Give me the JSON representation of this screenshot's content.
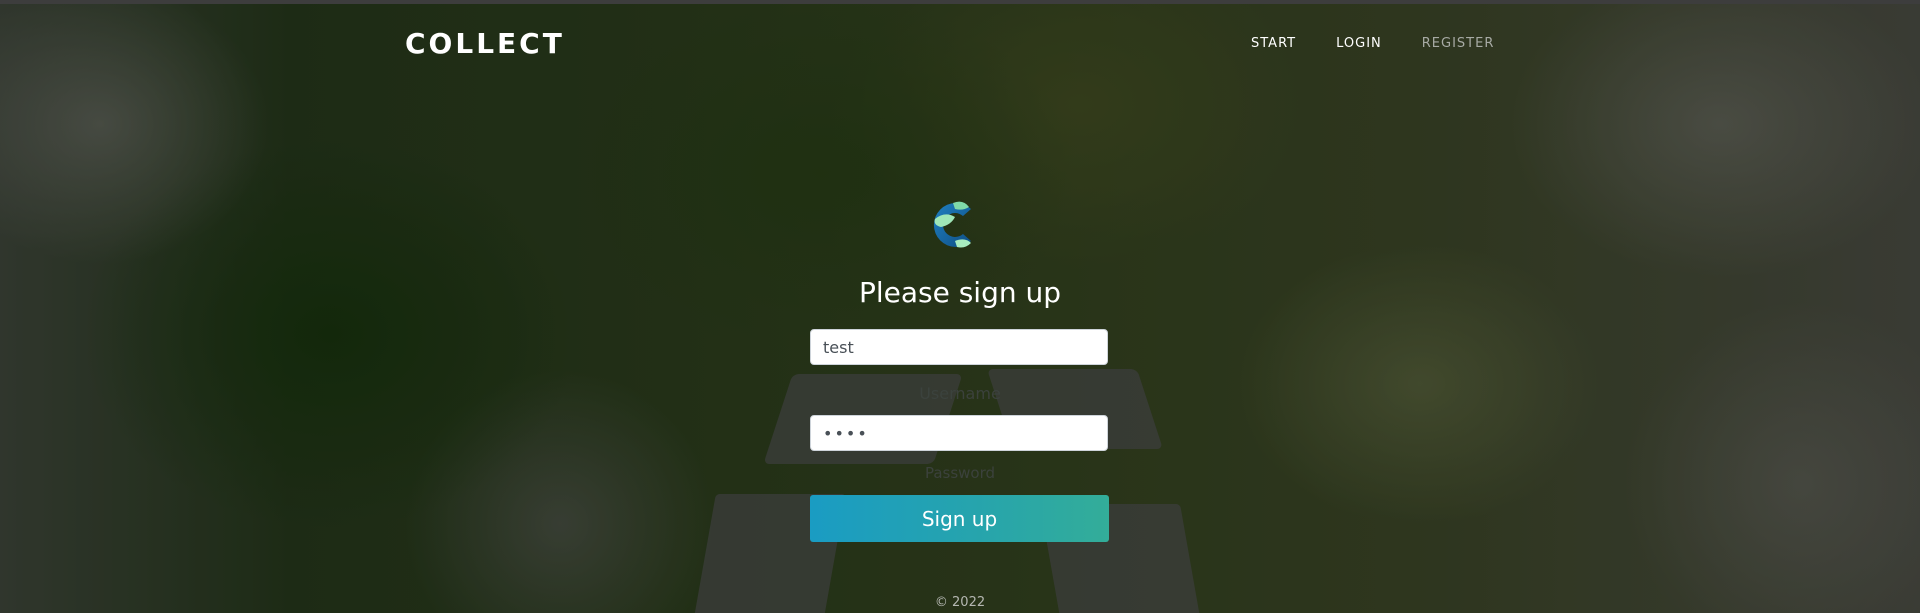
{
  "header": {
    "brand": "COLLECT",
    "nav": [
      {
        "label": "START"
      },
      {
        "label": "LOGIN"
      },
      {
        "label": "REGISTER"
      }
    ]
  },
  "form": {
    "title": "Please sign up",
    "username": {
      "value": "test",
      "label": "Username"
    },
    "password": {
      "value": "test",
      "label": "Password"
    },
    "submit_label": "Sign up"
  },
  "footer": {
    "text": "© 2022"
  },
  "colors": {
    "button_start": "#1a9cc3",
    "button_end": "#33ad99",
    "nav_active": "#ffffff",
    "nav_muted": "#a7aaa4"
  },
  "icons": {
    "logo": "collect-logo-icon"
  }
}
